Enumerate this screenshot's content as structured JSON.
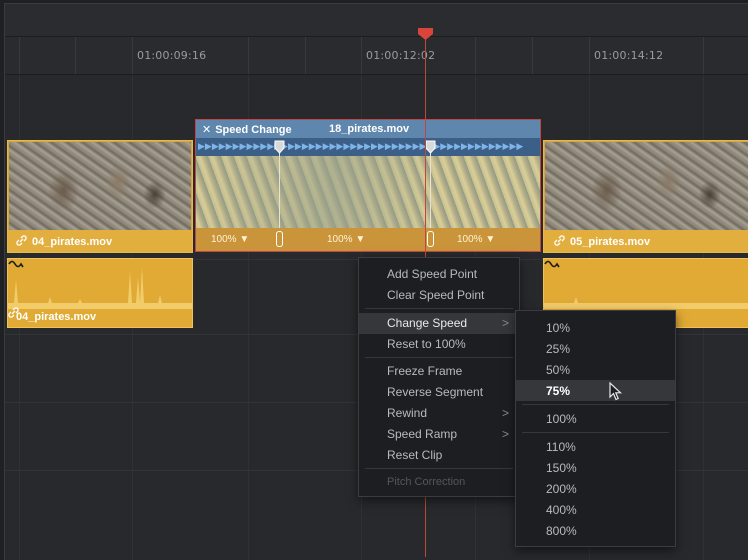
{
  "ruler": {
    "timecodes": [
      "01:00:09:16",
      "01:00:12:02",
      "01:00:14:12"
    ]
  },
  "clips": {
    "left_video_label": "04_pirates.mov",
    "right_video_label": "05_pirates.mov",
    "left_audio_label": "04_pirates.mov"
  },
  "speed_change": {
    "title": "Speed Change",
    "filename": "18_pirates.mov",
    "segments": [
      "100% ▼",
      "100% ▼",
      "100% ▼"
    ]
  },
  "context_menu": {
    "items": [
      "Add Speed Point",
      "Clear Speed Point",
      "Change Speed",
      "Reset to 100%",
      "Freeze Frame",
      "Reverse Segment",
      "Rewind",
      "Speed Ramp",
      "Reset Clip",
      "Pitch Correction"
    ],
    "submenu_arrow": ">"
  },
  "speed_submenu": {
    "options": [
      "10%",
      "25%",
      "50%",
      "75%",
      "100%",
      "110%",
      "150%",
      "200%",
      "400%",
      "800%"
    ],
    "selected": "75%"
  },
  "colors": {
    "clip": "#e2ae3e",
    "speed_header": "#5f86ad",
    "playhead": "#c4453b",
    "background": "#28292c"
  }
}
